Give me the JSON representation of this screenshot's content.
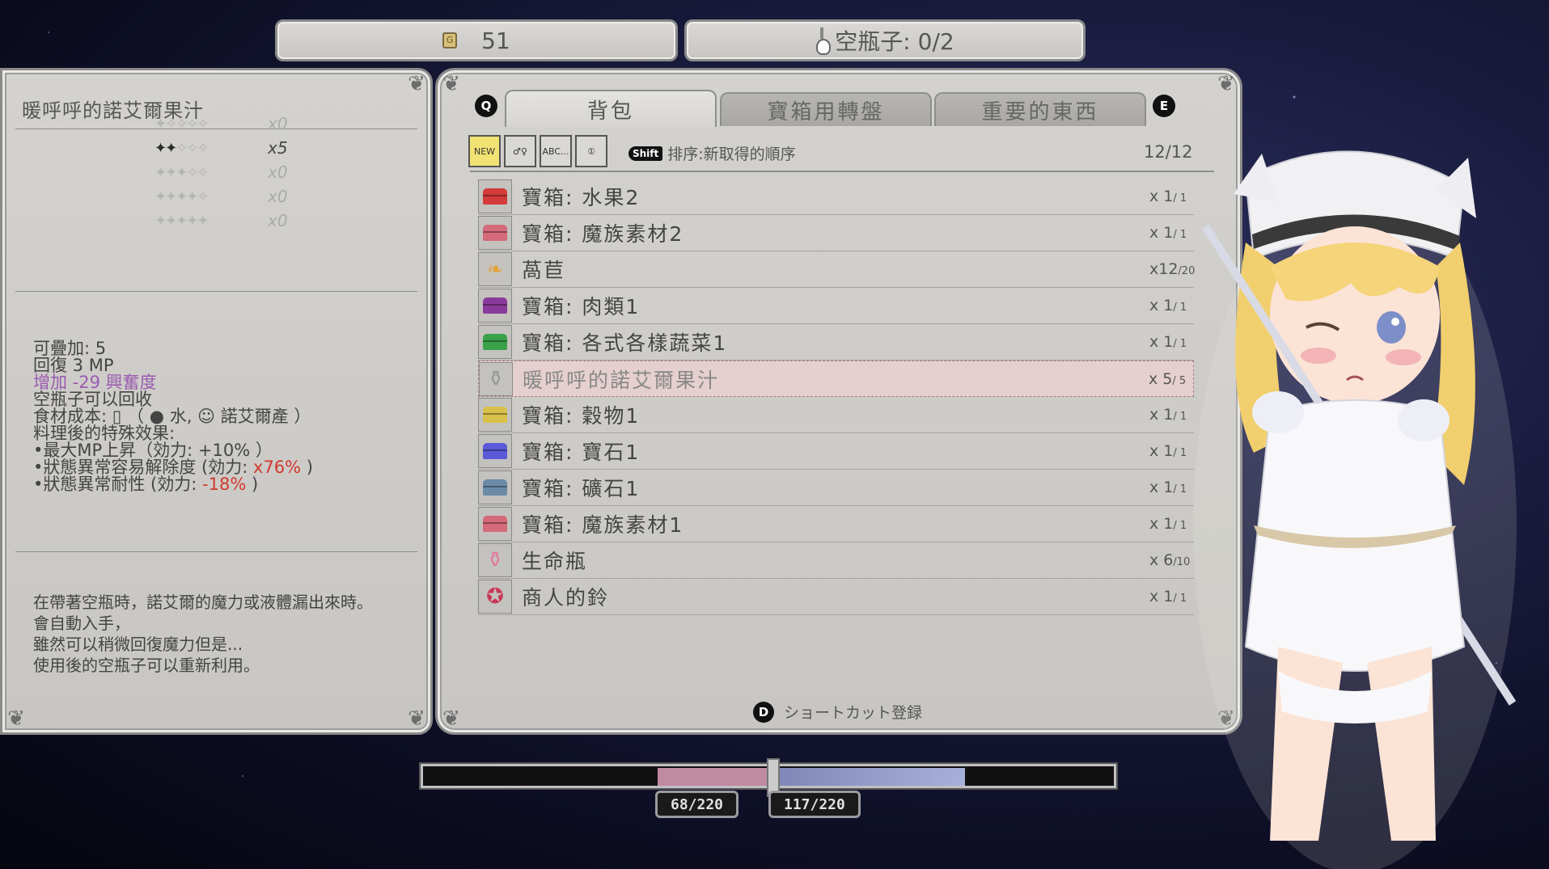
{
  "topbar": {
    "gold": "51",
    "bottles_label": "空瓶子: 0/2"
  },
  "left": {
    "item_title": "暖呼呼的諾艾爾果汁",
    "ranks": [
      {
        "stars": 1,
        "count": "x0",
        "active": false
      },
      {
        "stars": 2,
        "count": "x5",
        "active": true
      },
      {
        "stars": 3,
        "count": "x0",
        "active": false
      },
      {
        "stars": 4,
        "count": "x0",
        "active": false
      },
      {
        "stars": 5,
        "count": "x0",
        "active": false
      }
    ],
    "info": {
      "stack": "可疊加: 5",
      "restore": "回復 3 MP",
      "arousal": "增加 -29 興奮度",
      "recyclable": "空瓶子可以回收",
      "cost_prefix": "食材成本:",
      "cost_item1": "水,",
      "cost_item2": "諾艾爾產 ）",
      "special_title": "料理後的特殊效果:",
      "eff1": "•最大MP上昇（効力: +10% ）",
      "eff2_prefix": "•狀態異常容易解除度 (効力: ",
      "eff2_value": "x76%",
      "eff2_suffix": " )",
      "eff3_prefix": "•狀態異常耐性 (効力: ",
      "eff3_value": "-18%",
      "eff3_suffix": " )"
    },
    "description": [
      "在帶著空瓶時，諾艾爾的魔力或液體漏出來時。",
      "會自動入手，",
      "雖然可以稍微回復魔力但是...",
      "使用後的空瓶子可以重新利用。"
    ]
  },
  "main": {
    "key_left": "Q",
    "key_right": "E",
    "tabs": [
      "背包",
      "寶箱用轉盤",
      "重要的東西"
    ],
    "filters": [
      "NEW",
      "♂♀",
      "ABC...",
      "①"
    ],
    "sort_key": "Shift",
    "sort_label": "排序:新取得的順序",
    "count": "12/12",
    "items": [
      {
        "name": "寶箱: 水果2",
        "qty": "x 1",
        "max": "/ 1",
        "icon": "chest-red",
        "color": "#d33a3a"
      },
      {
        "name": "寶箱: 魔族素材2",
        "qty": "x 1",
        "max": "/ 1",
        "icon": "chest-pink",
        "color": "#d46a7a"
      },
      {
        "name": "萵苣",
        "qty": "x12",
        "max": "/20",
        "icon": "lettuce",
        "color": "#e5a23a"
      },
      {
        "name": "寶箱: 肉類1",
        "qty": "x 1",
        "max": "/ 1",
        "icon": "chest-purple",
        "color": "#8a3a9a"
      },
      {
        "name": "寶箱: 各式各樣蔬菜1",
        "qty": "x 1",
        "max": "/ 1",
        "icon": "chest-green",
        "color": "#3aa04a"
      },
      {
        "name": "暖呼呼的諾艾爾果汁",
        "qty": "x 5",
        "max": "/ 5",
        "icon": "bottle",
        "color": "#999999"
      },
      {
        "name": "寶箱: 穀物1",
        "qty": "x 1",
        "max": "/ 1",
        "icon": "chest-yellow",
        "color": "#d8c04a"
      },
      {
        "name": "寶箱: 寶石1",
        "qty": "x 1",
        "max": "/ 1",
        "icon": "chest-blue",
        "color": "#5a5ad8"
      },
      {
        "name": "寶箱: 礦石1",
        "qty": "x 1",
        "max": "/ 1",
        "icon": "chest-steel",
        "color": "#6a8aa8"
      },
      {
        "name": "寶箱: 魔族素材1",
        "qty": "x 1",
        "max": "/ 1",
        "icon": "chest-pink",
        "color": "#d46a7a"
      },
      {
        "name": "生命瓶",
        "qty": "x 6",
        "max": "/10",
        "icon": "life-bottle",
        "color": "#e07aa0"
      },
      {
        "name": "商人的鈴",
        "qty": "x 1",
        "max": "/ 1",
        "icon": "bell",
        "color": "#c83a5a"
      }
    ],
    "selected_index": 5,
    "shortcut_key": "D",
    "shortcut_label": "ショートカット登録"
  },
  "gauge": {
    "left_value": "68/220",
    "right_value": "117/220",
    "left_fraction": 0.309,
    "right_fraction": 0.532
  }
}
